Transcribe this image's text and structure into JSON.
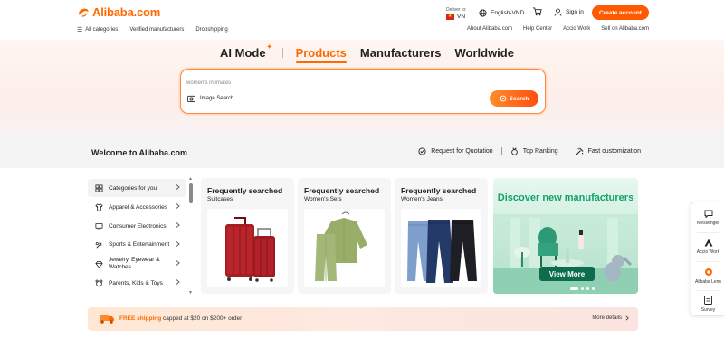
{
  "header": {
    "logo_text": "Alibaba.com",
    "deliver_label": "Deliver to:",
    "country_code": "VN",
    "language_currency": "English-VND",
    "sign_in": "Sign in",
    "create_account": "Create account",
    "brand_color": "#ff6a00"
  },
  "subnav": {
    "left": [
      "All categories",
      "Verified manufacturers",
      "Dropshipping"
    ],
    "right": [
      "About Alibaba.com",
      "Help Center",
      "Accio Work",
      "Sell on Alibaba.com"
    ]
  },
  "hero": {
    "tabs": [
      "AI Mode",
      "Products",
      "Manufacturers",
      "Worldwide"
    ],
    "active_tab": "Products",
    "search_value": "women's intimates",
    "image_search_label": "Image Search",
    "search_button": "Search"
  },
  "welcome": {
    "title": "Welcome to Alibaba.com",
    "links": [
      "Request for Quotation",
      "Top Ranking",
      "Fast customization"
    ]
  },
  "categories": [
    {
      "label": "Categories for you",
      "icon": "grid-icon"
    },
    {
      "label": "Apparel & Accessories",
      "icon": "shirt-icon"
    },
    {
      "label": "Consumer Electronics",
      "icon": "monitor-icon"
    },
    {
      "label": "Sports & Entertainment",
      "icon": "sports-icon"
    },
    {
      "label": "Jewelry, Eyewear & Watches",
      "icon": "diamond-icon"
    },
    {
      "label": "Parents, Kids & Toys",
      "icon": "toy-icon"
    }
  ],
  "cards": [
    {
      "title": "Frequently searched",
      "subtitle": "Suitcases"
    },
    {
      "title": "Frequently searched",
      "subtitle": "Women's Sets"
    },
    {
      "title": "Frequently searched",
      "subtitle": "Women's Jeans"
    }
  ],
  "discover": {
    "title": "Discover new manufacturers",
    "button": "View More"
  },
  "float_panel": [
    "Messenger",
    "Accio Work",
    "Alibaba Lens",
    "Survey"
  ],
  "shipping": {
    "highlight": "FREE shipping",
    "text": " capped at $20 on $200+ order",
    "more": "More details"
  }
}
